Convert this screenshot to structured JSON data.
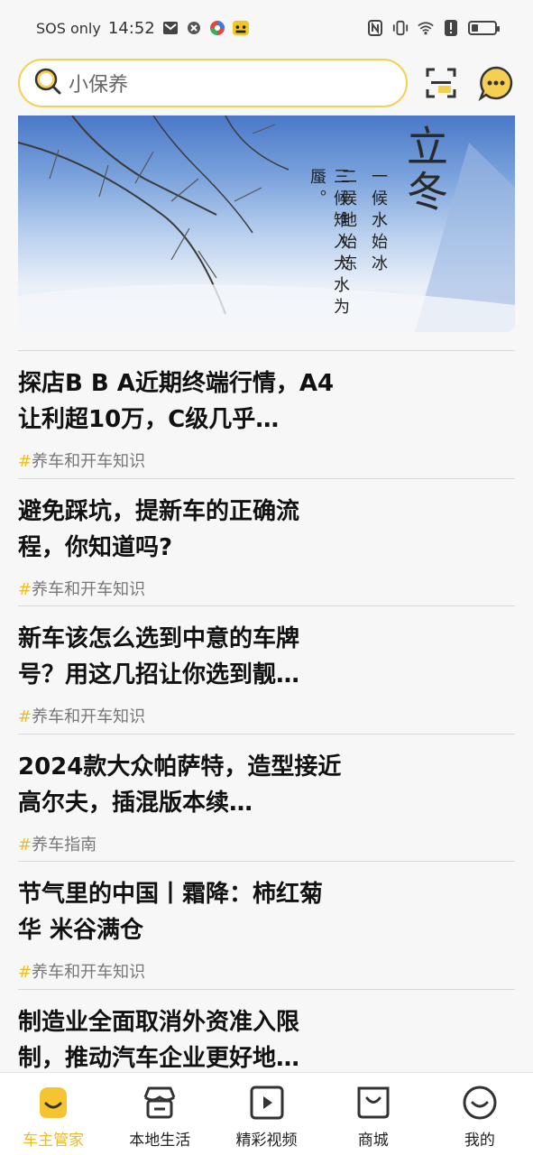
{
  "status_bar": {
    "network": "SOS only",
    "time": "14:52"
  },
  "search": {
    "placeholder": "小保养"
  },
  "banner": {
    "title": "立冬",
    "lines": [
      "一候水始冰",
      "二候地始冻",
      "三候雉入大水为蜃。"
    ]
  },
  "articles": [
    {
      "title": "探店B B A近期终端行情，A4让利超10万，C级几乎…",
      "tag": "养车和开车知识"
    },
    {
      "title": "避免踩坑，提新车的正确流程，你知道吗?",
      "tag": "养车和开车知识"
    },
    {
      "title": "新车该怎么选到中意的车牌号？用这几招让你选到靓…",
      "tag": "养车和开车知识"
    },
    {
      "title": "2024款大众帕萨特，造型接近高尔夫，插混版本续…",
      "tag": "养车指南"
    },
    {
      "title": "节气里的中国丨霜降：柿红菊华 米谷满仓",
      "tag": "养车和开车知识"
    },
    {
      "title": "制造业全面取消外资准入限制，推动汽车企业更好地…",
      "tag": ""
    }
  ],
  "tag_prefix": "#",
  "tabs": [
    {
      "label": "车主管家",
      "icon": "car-owner-icon",
      "active": true
    },
    {
      "label": "本地生活",
      "icon": "store-icon",
      "active": false
    },
    {
      "label": "精彩视频",
      "icon": "video-play-icon",
      "active": false
    },
    {
      "label": "商城",
      "icon": "shopping-bag-icon",
      "active": false
    },
    {
      "label": "我的",
      "icon": "profile-smile-icon",
      "active": false
    }
  ],
  "colors": {
    "accent": "#f5cf52",
    "active_tab": "#f0b82b"
  }
}
